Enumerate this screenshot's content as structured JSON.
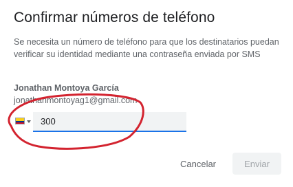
{
  "dialog": {
    "title": "Confirmar números de teléfono",
    "description": "Se necesita un número de teléfono para que los destinatarios puedan verificar su identidad mediante una contraseña enviada por SMS",
    "recipient": {
      "name": "Jonathan Montoya García",
      "email": "jonathanmontoyag1@gmail.com"
    },
    "phone": {
      "country_flag": "colombia-flag",
      "value": "300"
    },
    "actions": {
      "cancel_label": "Cancelar",
      "send_label": "Enviar"
    }
  },
  "colors": {
    "accent": "#1a73e8",
    "annotation": "#d3232f",
    "title_text": "#202124",
    "secondary_text": "#5f6368",
    "disabled_button_bg": "#f1f3f4"
  }
}
